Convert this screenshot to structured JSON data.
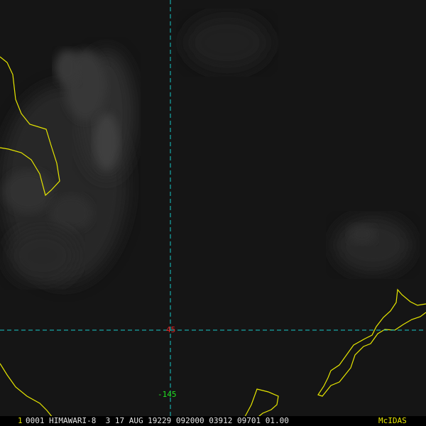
{
  "colors": {
    "coastline": "#e6e600",
    "gridline": "#18c8c8",
    "lat_label": "#e02020",
    "lon_label": "#20e020",
    "footer_text": "#e6e6e6",
    "brand": "#e6e600"
  },
  "grid": {
    "latitude_label": "45",
    "longitude_label": "-145"
  },
  "footer": {
    "frame_number": "1",
    "info": "0001 HIMAWARI-8  3 17 AUG 19229 092000 03912 09701 01.00",
    "brand": "McIDAS"
  }
}
